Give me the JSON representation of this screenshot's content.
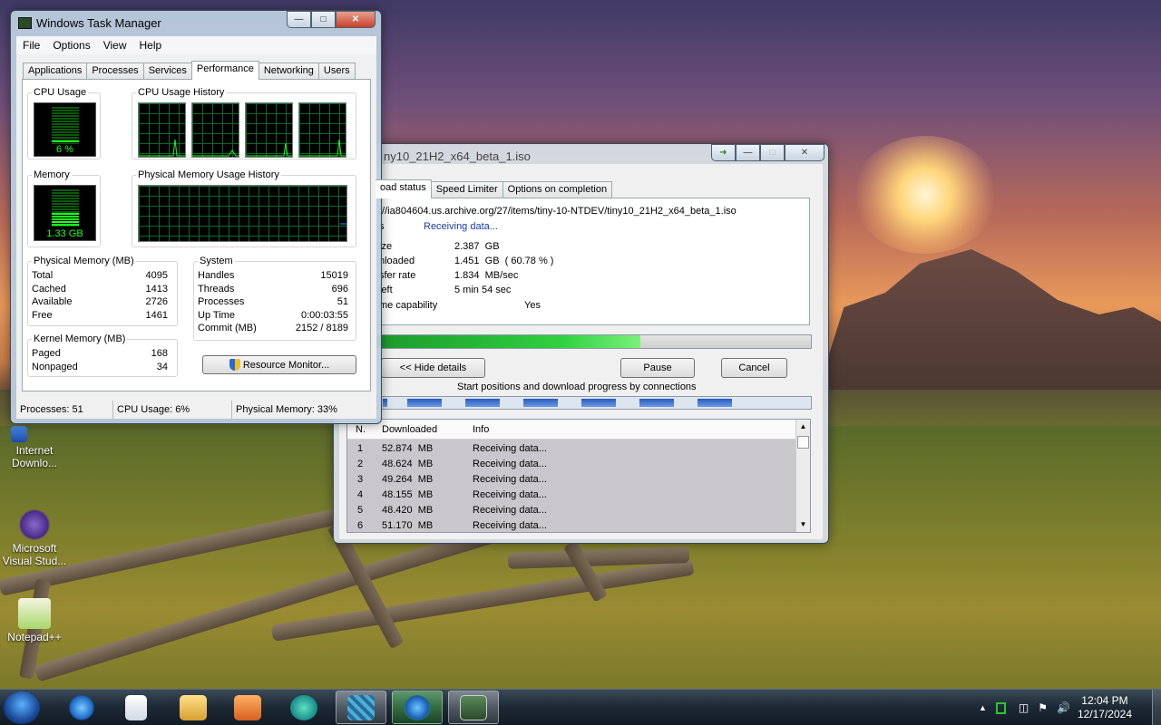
{
  "task_manager": {
    "title": "Windows Task Manager",
    "menu": [
      "File",
      "Options",
      "View",
      "Help"
    ],
    "tabs": [
      "Applications",
      "Processes",
      "Services",
      "Performance",
      "Networking",
      "Users"
    ],
    "active_tab": "Performance",
    "cpu_usage_label": "CPU Usage",
    "cpu_usage_value": "6 %",
    "cpu_fraction": 0.06,
    "cpu_history_label": "CPU Usage History",
    "memory_label": "Memory",
    "memory_value": "1.33 GB",
    "memory_fraction": 0.33,
    "phys_history_label": "Physical Memory Usage History",
    "physical_memory": {
      "label": "Physical Memory (MB)",
      "rows": [
        {
          "k": "Total",
          "v": "4095"
        },
        {
          "k": "Cached",
          "v": "1413"
        },
        {
          "k": "Available",
          "v": "2726"
        },
        {
          "k": "Free",
          "v": "1461"
        }
      ]
    },
    "system": {
      "label": "System",
      "rows": [
        {
          "k": "Handles",
          "v": "15019"
        },
        {
          "k": "Threads",
          "v": "696"
        },
        {
          "k": "Processes",
          "v": "51"
        },
        {
          "k": "Up Time",
          "v": "0:00:03:55"
        },
        {
          "k": "Commit (MB)",
          "v": "2152 / 8189"
        }
      ]
    },
    "kernel_memory": {
      "label": "Kernel Memory (MB)",
      "rows": [
        {
          "k": "Paged",
          "v": "168"
        },
        {
          "k": "Nonpaged",
          "v": "34"
        }
      ]
    },
    "resource_monitor_button": "Resource Monitor...",
    "status": {
      "processes": "Processes: 51",
      "cpu": "CPU Usage: 6%",
      "memory": "Physical Memory: 33%"
    }
  },
  "download": {
    "title": "ny10_21H2_x64_beta_1.iso",
    "tabs": [
      "oad status",
      "Speed Limiter",
      "Options on completion"
    ],
    "url": "://ia804604.us.archive.org/27/items/tiny-10-NTDEV/tiny10_21H2_x64_beta_1.iso",
    "status_label": "s",
    "status_value": "Receiving data...",
    "fields": [
      {
        "k": "ize",
        "v": "2.387  GB"
      },
      {
        "k": "nloaded",
        "v": "1.451  GB  ( 60.78 % )"
      },
      {
        "k": "sfer rate",
        "v": "1.834  MB/sec"
      },
      {
        "k": "left",
        "v": "5 min 54 sec"
      }
    ],
    "resume_label": "me capability",
    "resume_value": "Yes",
    "progress": 0.6078,
    "buttons": {
      "hide": "<< Hide details",
      "pause": "Pause",
      "cancel": "Cancel"
    },
    "connections_label": "Start positions and download progress by connections",
    "list_headers": {
      "n": "N.",
      "downloaded": "Downloaded",
      "info": "Info"
    },
    "connections": [
      {
        "n": "1",
        "dl": "52.874  MB",
        "info": "Receiving data..."
      },
      {
        "n": "2",
        "dl": "48.624  MB",
        "info": "Receiving data..."
      },
      {
        "n": "3",
        "dl": "49.264  MB",
        "info": "Receiving data..."
      },
      {
        "n": "4",
        "dl": "48.155  MB",
        "info": "Receiving data..."
      },
      {
        "n": "5",
        "dl": "48.420  MB",
        "info": "Receiving data..."
      },
      {
        "n": "6",
        "dl": "51.170  MB",
        "info": "Receiving data..."
      }
    ]
  },
  "desktop_icons": [
    {
      "label": "Internet Downlo...",
      "icon": "idm-shortcut-icon"
    },
    {
      "label": "Microsoft Visual Stud...",
      "icon": "visual-studio-icon"
    },
    {
      "label": "Notepad++",
      "icon": "notepadpp-icon"
    }
  ],
  "taskbar": {
    "apps": [
      "internet-explorer-icon",
      "notepad-icon",
      "file-explorer-icon",
      "media-player-icon",
      "edge-icon",
      "app-icon",
      "idm-icon",
      "task-manager-icon"
    ],
    "time": "12:04 PM",
    "date": "12/17/2024"
  },
  "colors": {
    "graph_green": "#1cff1c",
    "progress_green": "#30d040",
    "connection_blue": "#2a5ab8"
  }
}
